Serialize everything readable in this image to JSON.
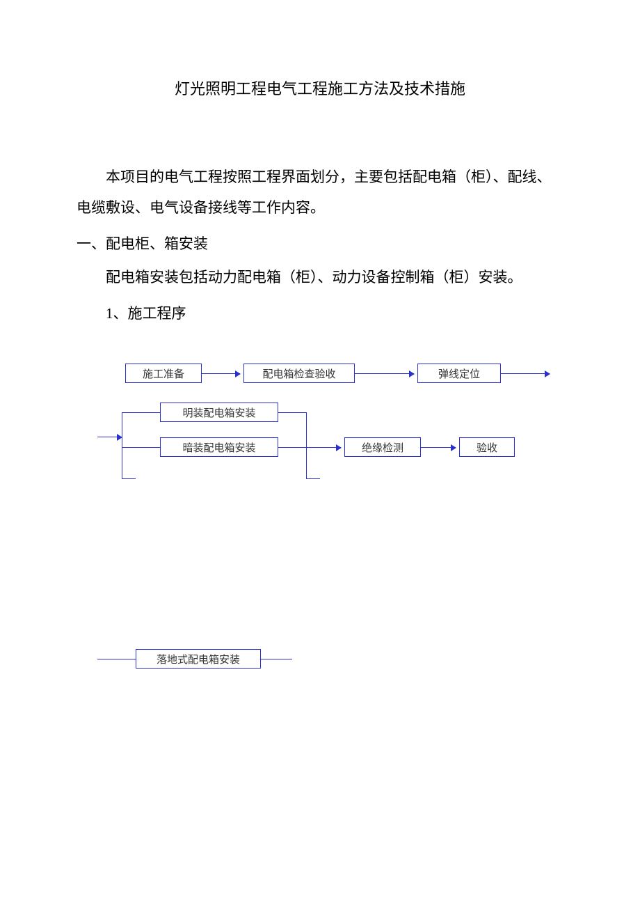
{
  "title": "灯光照明工程电气工程施工方法及技术措施",
  "paragraphs": {
    "intro": "本项目的电气工程按照工程界面划分，主要包括配电箱（柜）、配线、电缆敷设、电气设备接线等工作内容。",
    "section1_heading": "一、配电柜、箱安装",
    "section1_body": "配电箱安装包括动力配电箱（柜）、动力设备控制箱（柜）安装。",
    "item1": "1、施工程序"
  },
  "flow": {
    "row1": {
      "b1": "施工准备",
      "b2": "配电箱检查验收",
      "b3": "弹线定位"
    },
    "row2": {
      "b1": "明装配电箱安装",
      "b2": "暗装配电箱安装",
      "b3": "绝缘检测",
      "b4": "验收"
    },
    "row3": {
      "b1": "落地式配电箱安装"
    }
  },
  "colors": {
    "flow_border": "#2a2fcf"
  }
}
